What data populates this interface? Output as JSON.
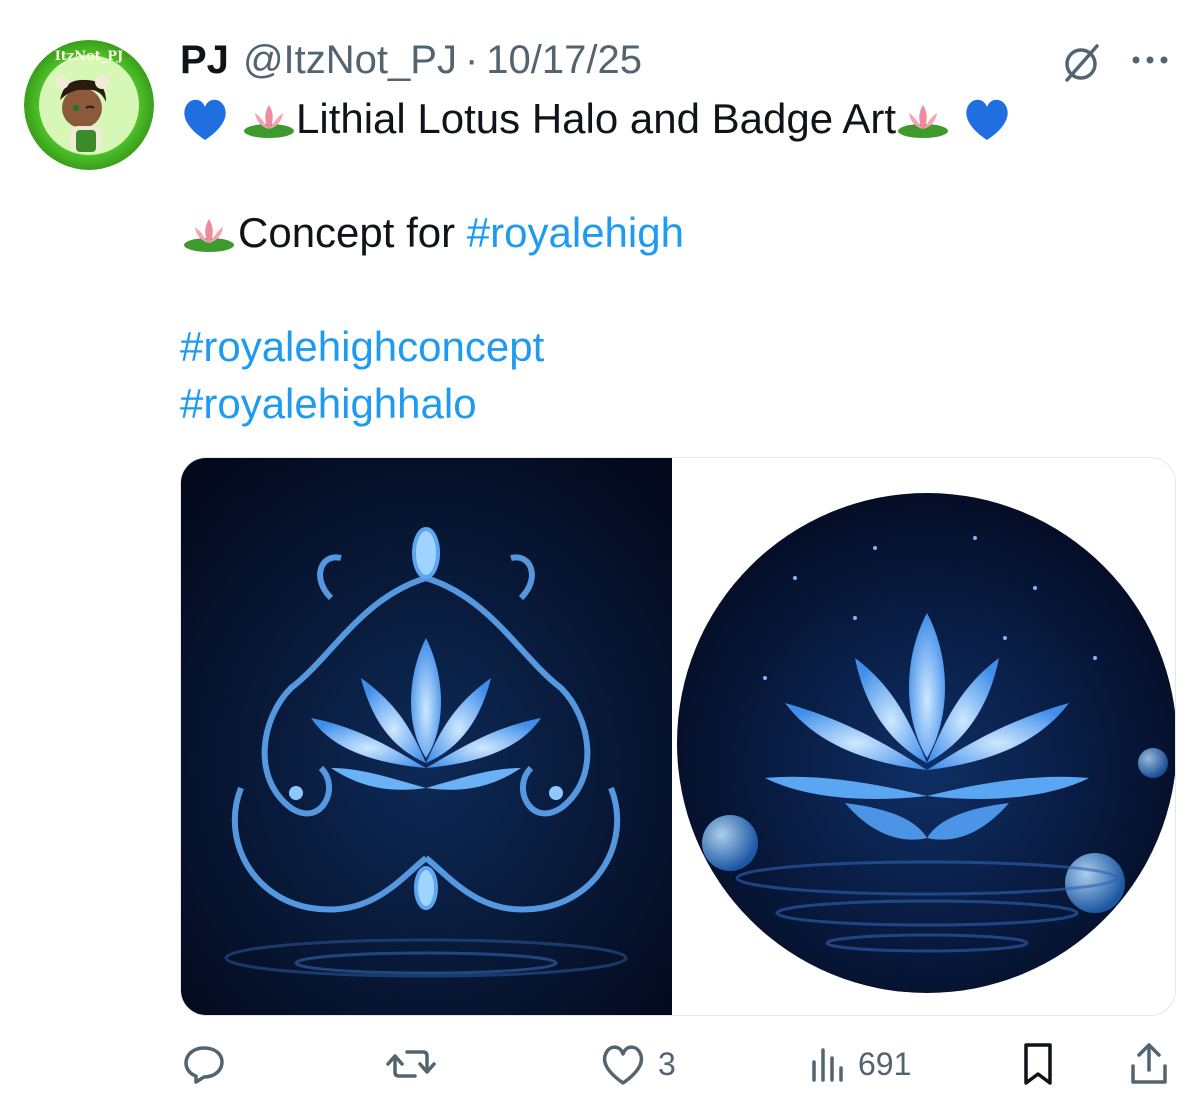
{
  "tweet": {
    "display_name": "PJ",
    "handle": "@ItzNot_PJ",
    "separator": "·",
    "date": "10/17/25",
    "avatar_text": "ItzNot_PJ",
    "lines": {
      "title": "Lithial Lotus Halo and Badge Art",
      "concept_prefix": "Concept for ",
      "concept_tag": "#royalehigh",
      "tag_2": "#royalehighconcept",
      "tag_3": "#royalehighhalo"
    },
    "emojis": [
      "blue-heart",
      "lotus"
    ],
    "media": [
      {
        "name": "halo-art",
        "description_icon": "lotus-tiara-image"
      },
      {
        "name": "badge-art",
        "description_icon": "lotus-badge-image"
      }
    ]
  },
  "actions": {
    "reply": {
      "icon": "reply-icon",
      "count": ""
    },
    "repost": {
      "icon": "repost-icon",
      "count": ""
    },
    "like": {
      "icon": "heart-icon",
      "count": "3"
    },
    "views": {
      "icon": "views-icon",
      "count": "691"
    },
    "bookmark": {
      "icon": "bookmark-icon",
      "count": ""
    },
    "share": {
      "icon": "share-icon",
      "count": ""
    }
  },
  "colors": {
    "link": "#1d9bf0",
    "secondary_text": "#536471",
    "primary_text": "#0f1419",
    "avatar_green": "#5fcf2e",
    "art_blue": "#4aa3ff"
  }
}
